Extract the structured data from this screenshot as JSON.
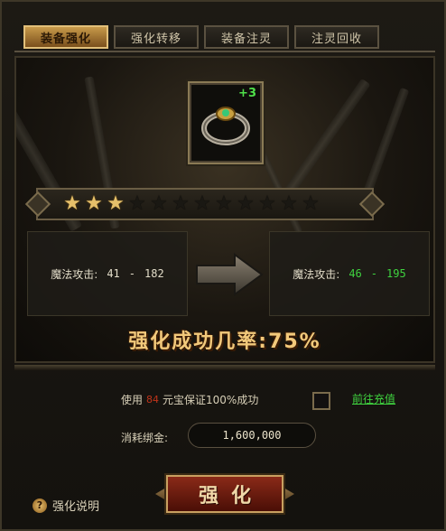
{
  "tabs": [
    {
      "label": "装备强化",
      "active": true
    },
    {
      "label": "强化转移",
      "active": false
    },
    {
      "label": "装备注灵",
      "active": false
    },
    {
      "label": "注灵回收",
      "active": false
    }
  ],
  "item": {
    "icon": "ring-icon",
    "enhance_level": "+3"
  },
  "stars": {
    "filled": 3,
    "total": 12
  },
  "stats": {
    "current": {
      "label": "魔法攻击:",
      "min": "41",
      "sep": "-",
      "max": "182"
    },
    "next": {
      "label": "魔法攻击:",
      "min": "46",
      "sep": "-",
      "max": "195"
    }
  },
  "success_rate_text": "强化成功几率:75%",
  "guarantee": {
    "prefix": "使用",
    "cost": "84",
    "suffix": "元宝保证100%成功",
    "recharge_label": "前往充值"
  },
  "gold": {
    "label": "消耗绑金:",
    "value": "1,600,000"
  },
  "enhance_button": {
    "label": "强化"
  },
  "help": {
    "label": "强化说明"
  },
  "colors": {
    "accent_gold": "#f2c97b",
    "green": "#3fd23f",
    "cost_red": "#c0341a"
  }
}
